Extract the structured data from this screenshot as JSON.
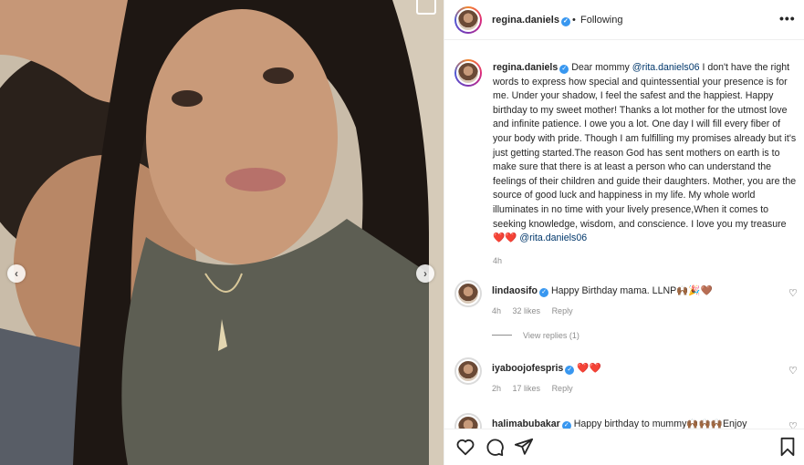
{
  "post": {
    "username": "regina.daniels",
    "separator": "•",
    "follow_status": "Following",
    "more": "•••"
  },
  "caption": {
    "username": "regina.daniels",
    "part1": " Dear mommy ",
    "mention1": "@rita.daniels06",
    "part2": " I don't have the right words to express how special and quintessential your presence is for me. Under your shadow, I feel the safest and the happiest. Happy birthday to my sweet mother! Thanks a lot mother for the utmost love and infinite patience. I owe you a lot. One day I will fill every fiber of your body with pride. Though I am fulfilling my promises already but it's just getting started.The reason God has sent mothers on earth is to make sure that there is at least a person who can understand the feelings of their children and guide their daughters. Mother, you are the source of good luck and happiness in my life. My whole world illuminates in no time with your lively presence,When it comes to seeking knowledge, wisdom, and conscience. I love you my treasure ",
    "emojis": "❤️❤️",
    "mention2": "@rita.daniels06",
    "time": "4h"
  },
  "comments": [
    {
      "username": "lindaosifo",
      "text": "Happy Birthday mama. LLNP🙌🏾🎉🤎",
      "time": "4h",
      "likes": "32 likes",
      "reply": "Reply",
      "view_replies": "View replies (1)"
    },
    {
      "username": "iyaboojofespris",
      "text": "❤️❤️",
      "time": "2h",
      "likes": "17 likes",
      "reply": "Reply"
    },
    {
      "username": "halimabubakar",
      "text": "Happy birthday to mummy🙌🏾🙌🏾🙌🏾Enjoy"
    }
  ],
  "icons": {
    "like": "heart-icon",
    "comment": "comment-icon",
    "share": "share-icon",
    "save": "bookmark-icon",
    "prev": "chevron-left-icon",
    "next": "chevron-right-icon"
  }
}
